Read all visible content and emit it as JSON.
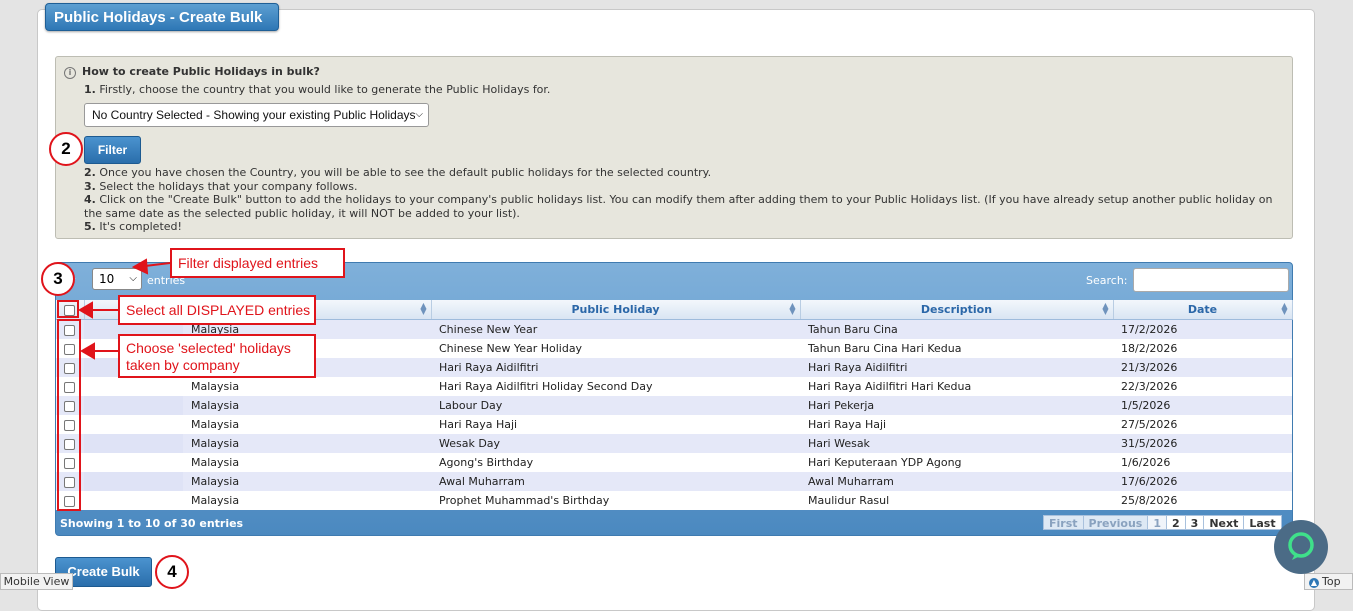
{
  "page": {
    "title": "Public Holidays - Create Bulk"
  },
  "info": {
    "heading": "How to create Public Holidays in bulk?",
    "step1_num": "1.",
    "step1": "Firstly, choose the country that you would like to generate the Public Holidays for.",
    "country_select_value": "No Country Selected - Showing your existing Public Holidays",
    "filter_label": "Filter",
    "step2_num": "2.",
    "step2": "Once you have chosen the Country, you will be able to see the default public holidays for the selected country.",
    "step3_num": "3.",
    "step3": "Select the holidays that your company follows.",
    "step4_num": "4.",
    "step4": "Click on the \"Create Bulk\" button to add the holidays to your company's public holidays list. You can modify them after adding them to your Public Holidays list. (If you have already setup another public holiday on the same date as the selected public holiday, it will NOT be added to your list).",
    "step5_num": "5.",
    "step5": "It's completed!"
  },
  "table": {
    "show_label": "ow",
    "length_value": "10",
    "entries_label": "entries",
    "search_label": "Search:",
    "headers": {
      "country": "ry",
      "holiday": "Public Holiday",
      "description": "Description",
      "date": "Date"
    },
    "rows": [
      {
        "country": "Malaysia",
        "holiday": "Chinese New Year",
        "description": "Tahun Baru Cina",
        "date": "17/2/2026"
      },
      {
        "country": "Malaysia",
        "holiday": "Chinese New Year Holiday",
        "description": "Tahun Baru Cina Hari Kedua",
        "date": "18/2/2026"
      },
      {
        "country": "Malaysia",
        "holiday": "Hari Raya Aidilfitri",
        "description": "Hari Raya Aidilfitri",
        "date": "21/3/2026"
      },
      {
        "country": "Malaysia",
        "holiday": "Hari Raya Aidilfitri Holiday Second Day",
        "description": "Hari Raya Aidilfitri Hari Kedua",
        "date": "22/3/2026"
      },
      {
        "country": "Malaysia",
        "holiday": "Labour Day",
        "description": "Hari Pekerja",
        "date": "1/5/2026"
      },
      {
        "country": "Malaysia",
        "holiday": "Hari Raya Haji",
        "description": "Hari Raya Haji",
        "date": "27/5/2026"
      },
      {
        "country": "Malaysia",
        "holiday": "Wesak Day",
        "description": "Hari Wesak",
        "date": "31/5/2026"
      },
      {
        "country": "Malaysia",
        "holiday": "Agong's Birthday",
        "description": "Hari Keputeraan YDP Agong",
        "date": "1/6/2026"
      },
      {
        "country": "Malaysia",
        "holiday": "Awal Muharram",
        "description": "Awal Muharram",
        "date": "17/6/2026"
      },
      {
        "country": "Malaysia",
        "holiday": "Prophet Muhammad's Birthday",
        "description": "Maulidur Rasul",
        "date": "25/8/2026"
      }
    ],
    "footer_info": "Showing 1 to 10 of 30 entries",
    "pager": {
      "first": "First",
      "previous": "Previous",
      "p1": "1",
      "p2": "2",
      "p3": "3",
      "next": "Next",
      "last": "Last"
    }
  },
  "actions": {
    "create_bulk": "Create Bulk",
    "mobile_view": "Mobile View",
    "top": "Top"
  },
  "annotations": {
    "c2": "2",
    "c3": "3",
    "c4": "4",
    "filter_entries": "Filter displayed entries",
    "select_all": "Select all DISPLAYED entries",
    "choose_line1": "Choose 'selected' holidays",
    "choose_line2": "taken by company"
  },
  "colors": {
    "accent": "#2e77b5",
    "annotation": "#e0141b"
  }
}
